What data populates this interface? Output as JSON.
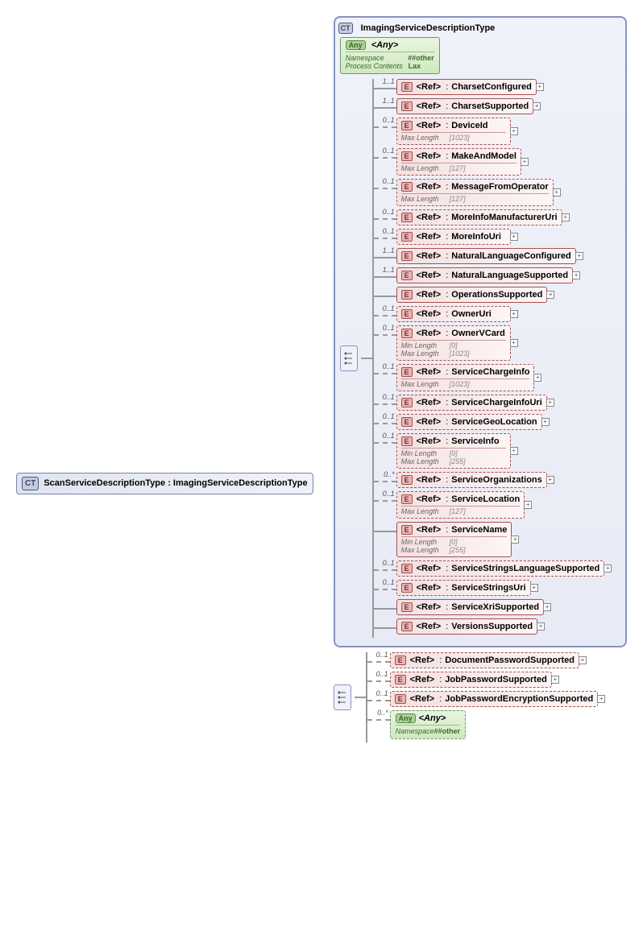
{
  "root": {
    "badge": "CT",
    "label": "ScanServiceDescriptionType : ImagingServiceDescriptionType"
  },
  "ctGroup": {
    "badge": "CT",
    "title": "ImagingServiceDescriptionType",
    "any": {
      "badge": "Any",
      "title": "<Any>",
      "namespace_label": "Namespace",
      "namespace_value": "##other",
      "process_label": "Process Contents",
      "process_value": "Lax"
    }
  },
  "refLabel": "<Ref>",
  "elements": [
    {
      "occurs": "1..1",
      "name": "CharsetConfigured",
      "dashed": false,
      "plus": true
    },
    {
      "occurs": "1..1",
      "name": "CharsetSupported",
      "dashed": false,
      "plus": true
    },
    {
      "occurs": "0..1",
      "name": "DeviceId",
      "dashed": true,
      "plus": true,
      "meta": [
        {
          "label": "Max Length",
          "value": "[1023]"
        }
      ]
    },
    {
      "occurs": "0..1",
      "name": "MakeAndModel",
      "dashed": true,
      "plus": true,
      "meta": [
        {
          "label": "Max Length",
          "value": "[127]"
        }
      ]
    },
    {
      "occurs": "0..1",
      "name": "MessageFromOperator",
      "dashed": true,
      "plus": true,
      "meta": [
        {
          "label": "Max Length",
          "value": "[127]"
        }
      ]
    },
    {
      "occurs": "0..1",
      "name": "MoreInfoManufacturerUri",
      "dashed": true,
      "plus": true
    },
    {
      "occurs": "0..1",
      "name": "MoreInfoUri",
      "dashed": true,
      "plus": true
    },
    {
      "occurs": "1..1",
      "name": "NaturalLanguageConfigured",
      "dashed": false,
      "plus": true
    },
    {
      "occurs": "1..1",
      "name": "NaturalLanguageSupported",
      "dashed": false,
      "plus": true
    },
    {
      "occurs": "",
      "name": "OperationsSupported",
      "dashed": false,
      "plus": true
    },
    {
      "occurs": "0..1",
      "name": "OwnerUri",
      "dashed": true,
      "plus": true
    },
    {
      "occurs": "0..1",
      "name": "OwnerVCard",
      "dashed": true,
      "plus": true,
      "meta": [
        {
          "label": "Min Length",
          "value": "[0]"
        },
        {
          "label": "Max Length",
          "value": "[1023]"
        }
      ]
    },
    {
      "occurs": "0..1",
      "name": "ServiceChargeInfo",
      "dashed": true,
      "plus": true,
      "meta": [
        {
          "label": "Max Length",
          "value": "[1023]"
        }
      ]
    },
    {
      "occurs": "0..1",
      "name": "ServiceChargeInfoUri",
      "dashed": true,
      "plus": true
    },
    {
      "occurs": "0..1",
      "name": "ServiceGeoLocation",
      "dashed": true,
      "plus": true
    },
    {
      "occurs": "0..1",
      "name": "ServiceInfo",
      "dashed": true,
      "plus": true,
      "meta": [
        {
          "label": "Min Length",
          "value": "[0]"
        },
        {
          "label": "Max Length",
          "value": "[255]"
        }
      ]
    },
    {
      "occurs": "0..*",
      "name": "ServiceOrganizations",
      "dashed": true,
      "plus": true
    },
    {
      "occurs": "0..1",
      "name": "ServiceLocation",
      "dashed": true,
      "plus": true,
      "meta": [
        {
          "label": "Max Length",
          "value": "[127]"
        }
      ]
    },
    {
      "occurs": "",
      "name": "ServiceName",
      "dashed": false,
      "plus": true,
      "meta": [
        {
          "label": "Min Length",
          "value": "[0]"
        },
        {
          "label": "Max Length",
          "value": "[255]"
        }
      ]
    },
    {
      "occurs": "0..1",
      "name": "ServiceStringsLanguageSupported",
      "dashed": true,
      "plus": true
    },
    {
      "occurs": "0..1",
      "name": "ServiceStringsUri",
      "dashed": true,
      "plus": true
    },
    {
      "occurs": "",
      "name": "ServiceXriSupported",
      "dashed": false,
      "plus": true
    },
    {
      "occurs": "",
      "name": "VersionsSupported",
      "dashed": false,
      "plus": true
    }
  ],
  "extElements": [
    {
      "occurs": "0..1",
      "name": "DocumentPasswordSupported",
      "dashed": true,
      "plus": true
    },
    {
      "occurs": "0..1",
      "name": "JobPasswordSupported",
      "dashed": true,
      "plus": true
    },
    {
      "occurs": "0..1",
      "name": "JobPasswordEncryptionSupported",
      "dashed": true,
      "plus": true
    }
  ],
  "extAny": {
    "occurs": "0..*",
    "badge": "Any",
    "title": "<Any>",
    "namespace_label": "Namespace",
    "namespace_value": "##other"
  }
}
